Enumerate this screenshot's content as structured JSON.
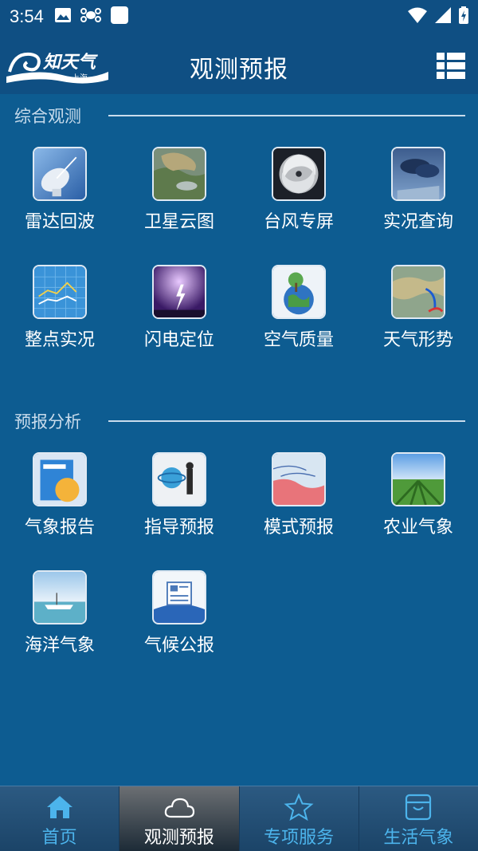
{
  "status_bar": {
    "time": "3:54",
    "left_icons": [
      "image-icon",
      "drone-icon",
      "square-icon"
    ],
    "right_icons": [
      "wifi-icon",
      "signal-icon",
      "battery-icon"
    ]
  },
  "header": {
    "logo_text": "知天气",
    "logo_sub": "上海",
    "title": "观测预报",
    "menu_icon": "grid-list-icon"
  },
  "sections": [
    {
      "title": "综合观测",
      "items": [
        {
          "label": "雷达回波",
          "icon": "radar-icon"
        },
        {
          "label": "卫星云图",
          "icon": "satellite-icon"
        },
        {
          "label": "台风专屏",
          "icon": "typhoon-icon"
        },
        {
          "label": "实况查询",
          "icon": "live-weather-icon"
        },
        {
          "label": "整点实况",
          "icon": "chart-icon"
        },
        {
          "label": "闪电定位",
          "icon": "lightning-icon"
        },
        {
          "label": "空气质量",
          "icon": "air-quality-icon"
        },
        {
          "label": "天气形势",
          "icon": "weather-map-icon"
        }
      ]
    },
    {
      "title": "预报分析",
      "items": [
        {
          "label": "气象报告",
          "icon": "report-icon"
        },
        {
          "label": "指导预报",
          "icon": "guidance-icon"
        },
        {
          "label": "模式预报",
          "icon": "model-map-icon"
        },
        {
          "label": "农业气象",
          "icon": "agriculture-icon"
        },
        {
          "label": "海洋气象",
          "icon": "ocean-icon"
        },
        {
          "label": "气候公报",
          "icon": "bulletin-icon"
        }
      ]
    }
  ],
  "bottom_nav": [
    {
      "label": "首页",
      "icon": "home-icon",
      "active": false
    },
    {
      "label": "观测预报",
      "icon": "cloud-icon",
      "active": true
    },
    {
      "label": "专项服务",
      "icon": "star-icon",
      "active": false
    },
    {
      "label": "生活气象",
      "icon": "box-icon",
      "active": false
    }
  ],
  "colors": {
    "background": "#0d5c91",
    "header": "#0f4f83",
    "nav_label": "#4cb4ec"
  }
}
